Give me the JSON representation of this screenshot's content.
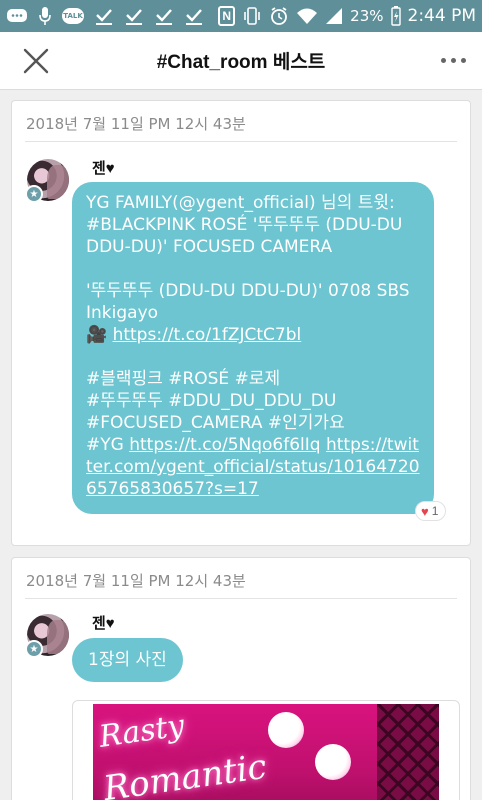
{
  "status_bar": {
    "battery": "23%",
    "time": "2:44 PM",
    "icons": [
      "chat-icon",
      "mic-icon",
      "talk-icon",
      "check-icon",
      "check-icon",
      "check-icon",
      "check-icon",
      "nfc-icon",
      "vibrate-icon",
      "alarm-icon",
      "wifi-icon",
      "signal-icon",
      "battery-icon"
    ],
    "talk_label": "TALK",
    "nfc_label": "N"
  },
  "header": {
    "title": "#Chat_room 베스트"
  },
  "messages": [
    {
      "date": "2018년 7월 11일 PM 12시 43분",
      "sender": "젠♥",
      "text_lines": {
        "l1": "YG FAMILY(@ygent_official) 님의 트윗:",
        "l2": "#BLACKPINK ROSÉ '뚜두뚜두 (DDU-DU DDU-DU)' FOCUSED CAMERA",
        "l3": "'뚜두뚜두 (DDU-DU DDU-DU)' 0708 SBS Inkigayo",
        "l4_prefix": "🎥 ",
        "link1": "https://t.co/1fZJCtC7bl",
        "l5": "#블랙핑크 #ROSÉ #로제",
        "l6": "#뚜두뚜두 #DDU_DU_DDU_DU",
        "l7": "#FOCUSED_CAMERA #인기가요",
        "l8_prefix": "#YG ",
        "link2": "https://t.co/5Nqo6f6lIq",
        "link3": "https://twitter.com/ygent_official/status/1016472065765830657?s=17"
      },
      "like_count": "1"
    },
    {
      "date": "2018년 7월 11일 PM 12시 43분",
      "sender": "젠♥",
      "text": "1장의 사진"
    }
  ],
  "colors": {
    "accent": "#6cc5d0",
    "status_bar": "#5f8f98",
    "heart": "#e5454f"
  }
}
